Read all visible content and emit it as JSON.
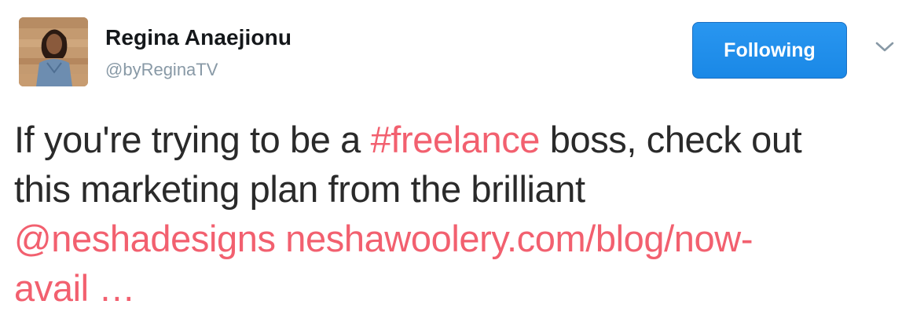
{
  "author": {
    "name": "Regina Anaejionu",
    "handle": "@byReginaTV"
  },
  "follow_button": {
    "label": "Following"
  },
  "colors": {
    "accent_link": "#f2606f",
    "button_blue": "#1d8fe9",
    "handle_gray": "#8899a6"
  },
  "tweet": {
    "line1": {
      "text1": "If you're trying to be a ",
      "hashtag": "#freelance",
      "text2": " boss, check out"
    },
    "line2": {
      "text": "this marketing plan from the brilliant"
    },
    "line3": {
      "mention": "@neshadesigns",
      "url_part1": "neshawoolery.com/blog/now-"
    },
    "line4": {
      "url_part2": "avail …"
    }
  },
  "icons": {
    "menu": "chevron-down-icon",
    "avatar": "avatar"
  }
}
